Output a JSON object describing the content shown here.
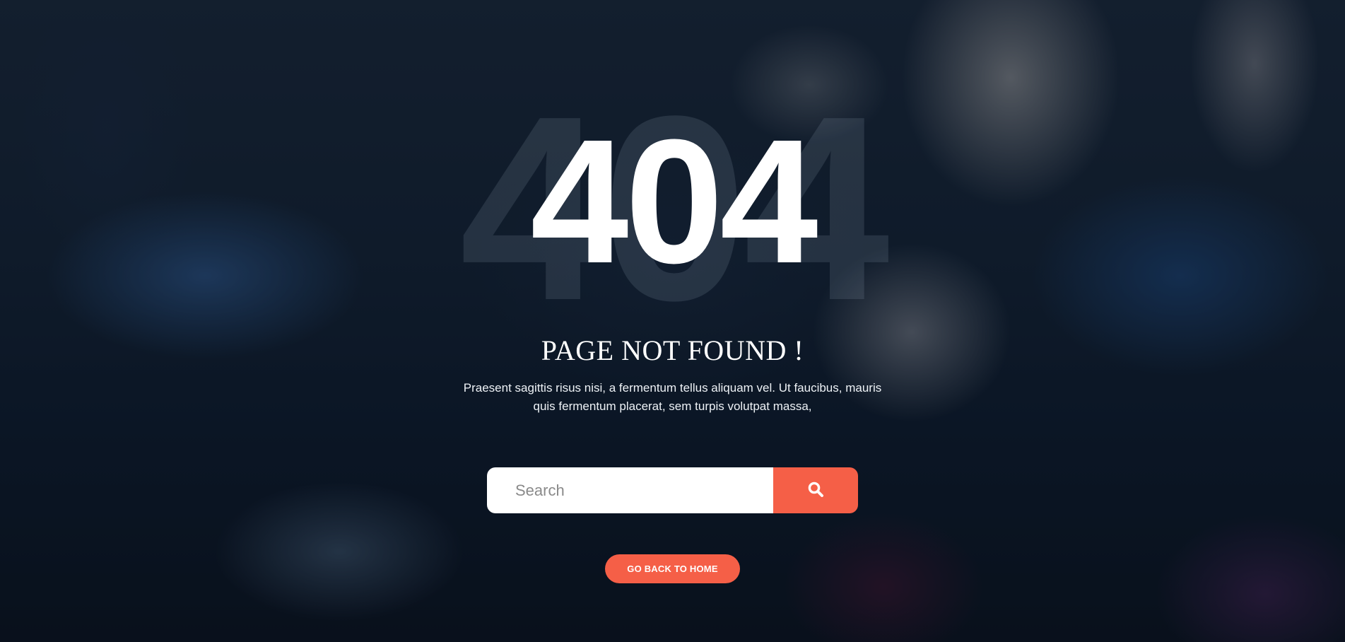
{
  "error": {
    "code": "404",
    "ghost_code": "404",
    "title": "PAGE NOT FOUND !",
    "description": "Praesent sagittis risus nisi, a fermentum tellus aliquam vel. Ut faucibus, mauris quis fermentum placerat, sem turpis volutpat massa,"
  },
  "search": {
    "placeholder": "Search",
    "value": "",
    "button_icon": "search-icon"
  },
  "home_button": {
    "label": "GO BACK TO HOME"
  },
  "colors": {
    "accent": "#f55f47",
    "text": "#ffffff",
    "overlay": "#0d1420"
  }
}
